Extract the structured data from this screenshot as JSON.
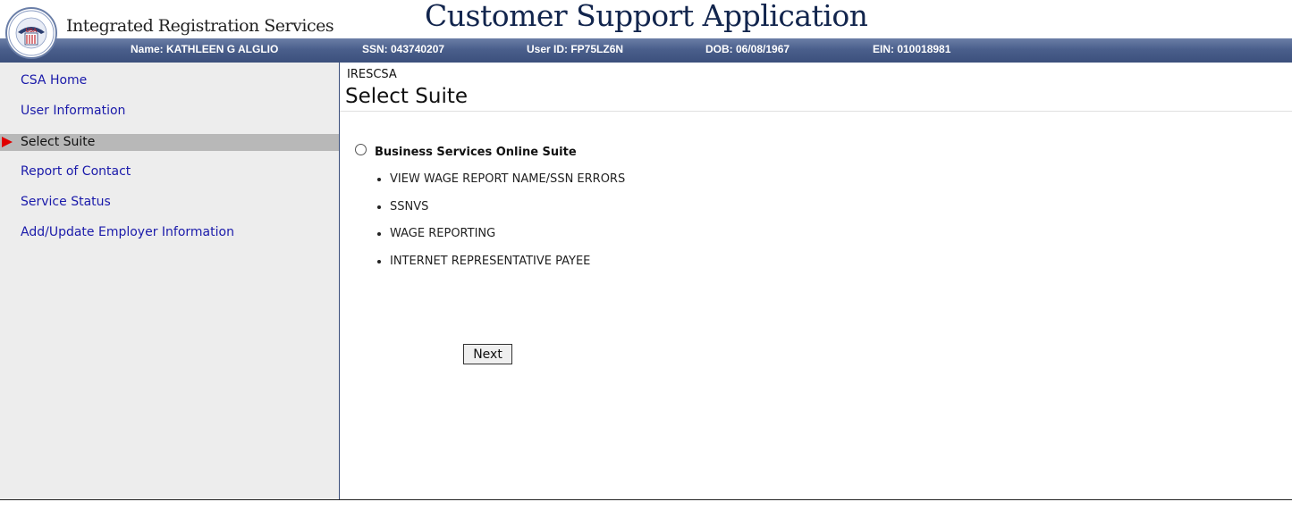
{
  "header": {
    "agency_name": "Integrated Registration Services",
    "app_title": "Customer Support Application",
    "seal_text": "USA"
  },
  "infobar": {
    "name": "Name: KATHLEEN G ALGLIO",
    "ssn": "SSN: 043740207",
    "user_id": "User ID: FP75LZ6N",
    "dob": "DOB: 06/08/1967",
    "ein": "EIN: 010018981"
  },
  "sidebar": {
    "items": [
      {
        "label": "CSA Home",
        "active": false
      },
      {
        "label": "User Information",
        "active": false
      },
      {
        "label": "Select Suite",
        "active": true
      },
      {
        "label": "Report of Contact",
        "active": false
      },
      {
        "label": "Service Status",
        "active": false
      },
      {
        "label": "Add/Update Employer Information",
        "active": false
      }
    ]
  },
  "main": {
    "breadcrumb": "IRESCSA",
    "title": "Select Suite",
    "suite": {
      "label": "Business Services Online Suite",
      "selected": false,
      "services": [
        "VIEW WAGE REPORT NAME/SSN ERRORS",
        "SSNVS",
        "WAGE REPORTING",
        "INTERNET REPRESENTATIVE PAYEE"
      ]
    },
    "next_label": "Next"
  },
  "colors": {
    "title_navy": "#12254d",
    "infobar_blue": "#4a5f8c",
    "link_blue": "#1a1aaa",
    "active_gray": "#b8b8b8",
    "sidebar_bg": "#ededed",
    "arrow_red": "#e00000"
  }
}
